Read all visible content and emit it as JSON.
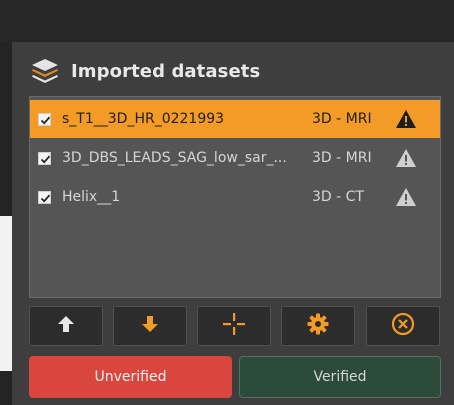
{
  "panel": {
    "title": "Imported datasets",
    "icon": "layers-icon"
  },
  "datasets": [
    {
      "checked": true,
      "name": "s_T1__3D_HR_0221993",
      "type": "3D - MRI",
      "warning": true,
      "selected": true
    },
    {
      "checked": true,
      "name": "3D_DBS_LEADS_SAG_low_sar_...",
      "type": "3D - MRI",
      "warning": true,
      "selected": false
    },
    {
      "checked": true,
      "name": "Helix__1",
      "type": "3D - CT",
      "warning": true,
      "selected": false
    }
  ],
  "toolbar": {
    "buttons": [
      "arrow-up-icon",
      "arrow-down-icon",
      "crosshair-icon",
      "gear-icon",
      "close-circle-icon"
    ]
  },
  "status": {
    "unverified_label": "Unverified",
    "verified_label": "Verified"
  },
  "colors": {
    "accent": "#f39b26",
    "unverified": "#d9463e",
    "verified": "#2c4b3b"
  }
}
